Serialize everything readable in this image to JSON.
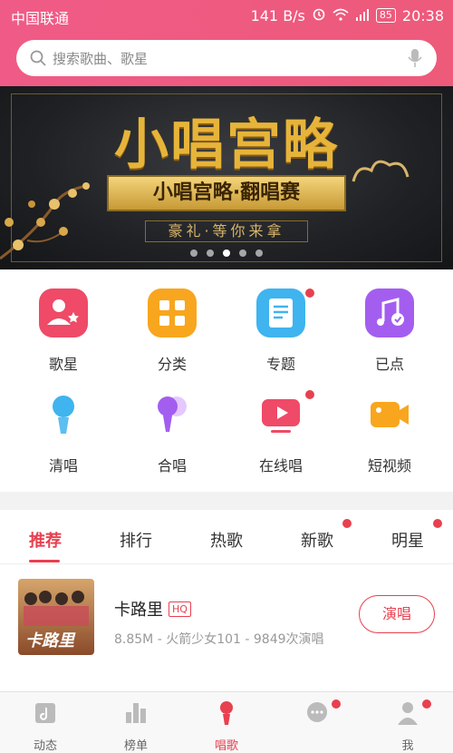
{
  "status_bar": {
    "carrier": "中国联通",
    "speed": "141 B/s",
    "battery": "85",
    "time": "20:38"
  },
  "search": {
    "placeholder": "搜索歌曲、歌星"
  },
  "banner": {
    "title": "小唱宫略",
    "subtitle": "小唱宫略·翻唱赛",
    "caption": "豪礼·等你来拿",
    "dots": 5,
    "active_dot": 3
  },
  "grid": [
    {
      "label": "歌星",
      "icon": "singer-icon",
      "color": "#ef4a67",
      "dot": false
    },
    {
      "label": "分类",
      "icon": "category-icon",
      "color": "#f8a61e",
      "dot": false
    },
    {
      "label": "专题",
      "icon": "topic-icon",
      "color": "#3fb4ef",
      "dot": true
    },
    {
      "label": "已点",
      "icon": "music-note-icon",
      "color": "#a35ef0",
      "dot": false
    },
    {
      "label": "清唱",
      "icon": "microphone-icon",
      "color": "#3fb4ef",
      "dot": false
    },
    {
      "label": "合唱",
      "icon": "duet-microphone-icon",
      "color": "#a35ef0",
      "dot": false
    },
    {
      "label": "在线唱",
      "icon": "video-play-icon",
      "color": "#ef4a67",
      "dot": true
    },
    {
      "label": "短视频",
      "icon": "video-camera-icon",
      "color": "#f8a61e",
      "dot": false
    }
  ],
  "tabs": [
    {
      "label": "推荐",
      "active": true,
      "dot": false
    },
    {
      "label": "排行",
      "active": false,
      "dot": false
    },
    {
      "label": "热歌",
      "active": false,
      "dot": false
    },
    {
      "label": "新歌",
      "active": false,
      "dot": true
    },
    {
      "label": "明星",
      "active": false,
      "dot": true
    }
  ],
  "songs": [
    {
      "name": "卡路里",
      "badge": "HQ",
      "meta": "8.85M - 火箭少女101 - 9849次演唱",
      "action": "演唱",
      "cover_text": "卡路里"
    }
  ],
  "bottom_nav": [
    {
      "label": "动态",
      "icon": "feed-icon",
      "active": false,
      "dot": false
    },
    {
      "label": "榜单",
      "icon": "chart-icon",
      "active": false,
      "dot": false
    },
    {
      "label": "唱歌",
      "icon": "microphone-icon",
      "active": true,
      "dot": false
    },
    {
      "label": "",
      "icon": "message-icon",
      "active": false,
      "dot": true
    },
    {
      "label": "我",
      "icon": "user-icon",
      "active": false,
      "dot": true
    }
  ],
  "colors": {
    "brand": "#e8404f",
    "top_bar": "#ef5b86"
  }
}
